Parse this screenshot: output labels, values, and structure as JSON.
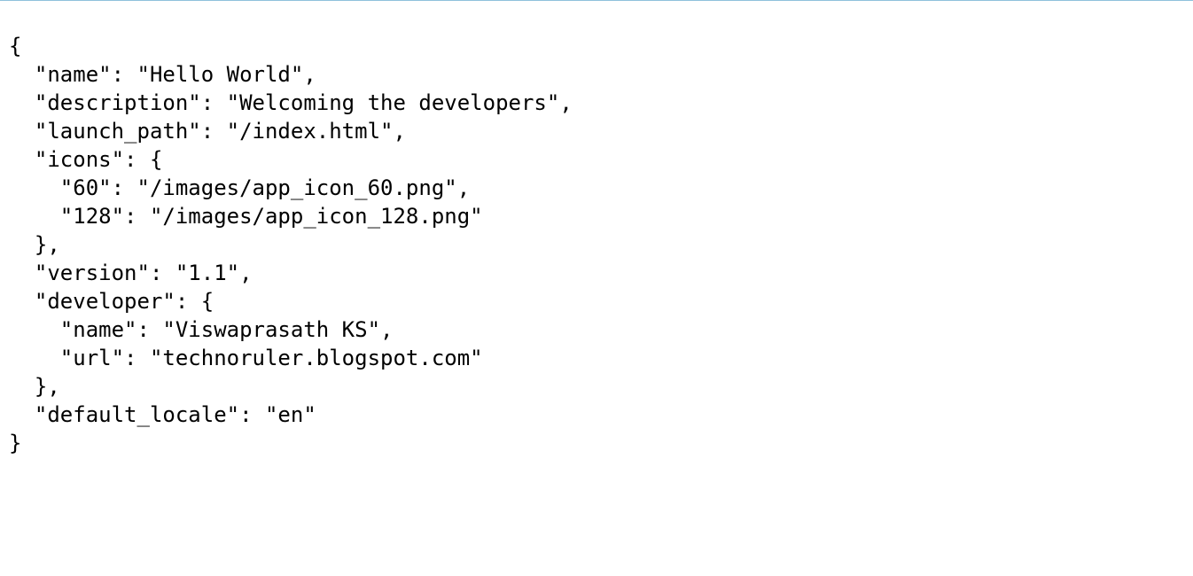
{
  "document": {
    "lines": [
      "{",
      "  \"name\": \"Hello World\",",
      "  \"description\": \"Welcoming the developers\",",
      "  \"launch_path\": \"/index.html\",",
      "  \"icons\": {",
      "    \"60\": \"/images/app_icon_60.png\",",
      "    \"128\": \"/images/app_icon_128.png\"",
      "  },",
      "  \"version\": \"1.1\",",
      "  \"developer\": {",
      "    \"name\": \"Viswaprasath KS\",",
      "    \"url\": \"technoruler.blogspot.com\"",
      "  },",
      "  \"default_locale\": \"en\"",
      "}"
    ]
  }
}
